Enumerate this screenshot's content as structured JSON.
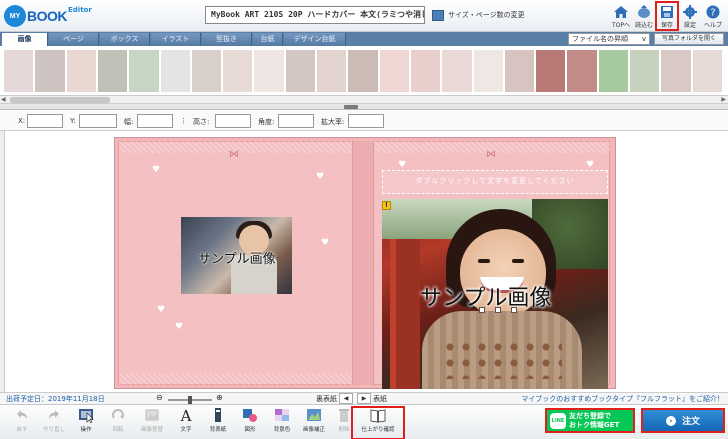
{
  "app": {
    "logo_badge": "MY",
    "logo_text": "BOOK",
    "logo_sup": "Editor",
    "product_name": "MyBook ART 210S 20P ハードカバー 本文(ラミつや消し)",
    "change_label": "サイズ・ページ数の変更"
  },
  "top_icons": [
    {
      "name": "home-icon",
      "label": "TOPへ"
    },
    {
      "name": "load-icon",
      "label": "読込む"
    },
    {
      "name": "save-icon",
      "label": "保存"
    },
    {
      "name": "settings-icon",
      "label": "設定"
    },
    {
      "name": "help-icon",
      "label": "ヘルプ"
    }
  ],
  "tabs": [
    "画像",
    "ページ",
    "ボックス",
    "イラスト",
    "型抜き",
    "台紙",
    "デザイン台紙"
  ],
  "sort": {
    "selected": "ファイル名の昇順",
    "arrow": "v"
  },
  "folder_button": "写真フォルダを開く",
  "thumb_colors": [
    "#e6d8d8",
    "#cfc3c1",
    "#e9d7d2",
    "#bfc0b6",
    "#c7d5c5",
    "#e4e4e4",
    "#d9cfcb",
    "#e8dbd6",
    "#efe6e3",
    "#d4c7c3",
    "#e3d3cf",
    "#cbbbb5",
    "#efd6d3",
    "#e8cfcc",
    "#ead9d7",
    "#efe7e3",
    "#d7c4c0",
    "#b97a77",
    "#c28b87",
    "#a6c9a0",
    "#c6d2be",
    "#d9c9c6",
    "#e7d9d6"
  ],
  "props": {
    "x": "X:",
    "y": "Y:",
    "width": "幅:",
    "height": "高さ:",
    "angle": "角度:",
    "scale": "拡大率:"
  },
  "canvas": {
    "front_text": "ダブルクリックして文字を変更してください",
    "sample_small": "サンプル画像",
    "sample_large": "サンプル画像"
  },
  "status": {
    "ship_date": "出荷予定日：2019年11月18日",
    "back_label": "裏表紙",
    "front_label": "表紙",
    "promo": "マイブックのおすすめブックタイプ『フルフラット』をご紹介！"
  },
  "tools": [
    {
      "name": "undo",
      "label": "戻す",
      "disabled": true
    },
    {
      "name": "redo",
      "label": "やり直し",
      "disabled": true
    },
    {
      "name": "operate",
      "label": "操作",
      "disabled": false
    },
    {
      "name": "rotate",
      "label": "回転",
      "disabled": true
    },
    {
      "name": "image-swap",
      "label": "画像差替",
      "disabled": true
    },
    {
      "name": "text",
      "label": "文字",
      "disabled": false
    },
    {
      "name": "spine",
      "label": "背表紙",
      "disabled": false
    },
    {
      "name": "shape",
      "label": "図形",
      "disabled": false
    },
    {
      "name": "bg-color",
      "label": "背景色",
      "disabled": false
    },
    {
      "name": "correction",
      "label": "画像補正",
      "disabled": false
    },
    {
      "name": "delete",
      "label": "削除",
      "disabled": true
    },
    {
      "name": "preview",
      "label": "仕上がり確認",
      "disabled": false
    }
  ],
  "line": {
    "logo": "LINE",
    "line1": "友だち登録で",
    "line2": "おトク情報GET"
  },
  "order": {
    "label": "注文",
    "icon": "›"
  }
}
